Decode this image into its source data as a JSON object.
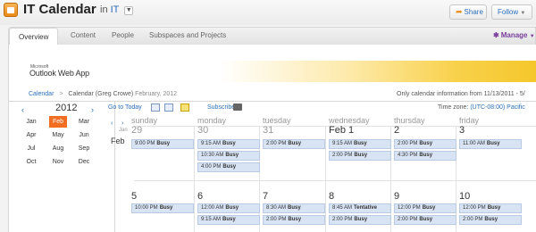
{
  "header": {
    "title": "IT Calendar",
    "in_prefix": "in",
    "space_link": "IT",
    "share_label": "Share",
    "follow_label": "Follow"
  },
  "tabs": [
    {
      "label": "Overview",
      "active": true
    },
    {
      "label": "Content"
    },
    {
      "label": "People"
    },
    {
      "label": "Subspaces and Projects"
    }
  ],
  "manage_label": "Manage",
  "owa": {
    "microsoft": "Microsoft",
    "logo": "Outlook Web App"
  },
  "breadcrumb": {
    "root": "Calendar",
    "current": "Calendar (Greg Crowe)",
    "date": "February, 2012"
  },
  "info_message": "Only calendar information from 11/13/2011 - 5/",
  "mini_cal": {
    "year": "2012",
    "months": [
      "Jan",
      "Feb",
      "Mar",
      "Apr",
      "May",
      "Jun",
      "Jul",
      "Aug",
      "Sep",
      "Oct",
      "Nov",
      "Dec"
    ],
    "selected": "Feb"
  },
  "toolbar": {
    "goto_today": "Go to Today",
    "subscribe": "Subscribe",
    "timezone_label": "Time zone:",
    "timezone_value": "(UTC-08:00) Pacific"
  },
  "days": [
    "sunday",
    "monday",
    "tuesday",
    "wednesday",
    "thursday",
    "friday"
  ],
  "month_label": "Feb",
  "week1": {
    "jan_label": "Jan",
    "dates": [
      "29",
      "30",
      "31",
      "Feb 1",
      "2",
      "3"
    ],
    "past": [
      true,
      true,
      true,
      false,
      false,
      false
    ],
    "events": [
      [
        {
          "time": "9:00 PM",
          "status": "Busy"
        }
      ],
      [
        {
          "time": "9:15 AM",
          "status": "Busy"
        },
        {
          "time": "10:30 AM",
          "status": "Busy"
        },
        {
          "time": "4:00 PM",
          "status": "Busy"
        }
      ],
      [
        {
          "time": "2:00 PM",
          "status": "Busy"
        }
      ],
      [
        {
          "time": "9:15 AM",
          "status": "Busy"
        },
        {
          "time": "2:00 PM",
          "status": "Busy"
        }
      ],
      [
        {
          "time": "2:00 PM",
          "status": "Busy"
        },
        {
          "time": "4:30 PM",
          "status": "Busy"
        }
      ],
      [
        {
          "time": "11:00 AM",
          "status": "Busy"
        }
      ]
    ]
  },
  "week2": {
    "dates": [
      "5",
      "6",
      "7",
      "8",
      "9",
      "10"
    ],
    "events": [
      [
        {
          "time": "10:00 PM",
          "status": "Busy"
        }
      ],
      [
        {
          "time": "12:00 AM",
          "status": "Busy"
        },
        {
          "time": "9:15 AM",
          "status": "Busy"
        }
      ],
      [
        {
          "time": "8:30 AM",
          "status": "Busy"
        },
        {
          "time": "2:00 PM",
          "status": "Busy"
        }
      ],
      [
        {
          "time": "8:45 AM",
          "status": "Tentative"
        },
        {
          "time": "2:00 PM",
          "status": "Busy"
        }
      ],
      [
        {
          "time": "12:00 PM",
          "status": "Busy"
        },
        {
          "time": "2:00 PM",
          "status": "Busy"
        }
      ],
      [
        {
          "time": "12:00 PM",
          "status": "Busy"
        },
        {
          "time": "2:00 PM",
          "status": "Busy"
        }
      ]
    ]
  },
  "colors": {
    "accent": "#2a6ebb",
    "selected_month": "#f26c22",
    "event_bg": "#d8e4f4",
    "manage": "#7a3e9d"
  }
}
